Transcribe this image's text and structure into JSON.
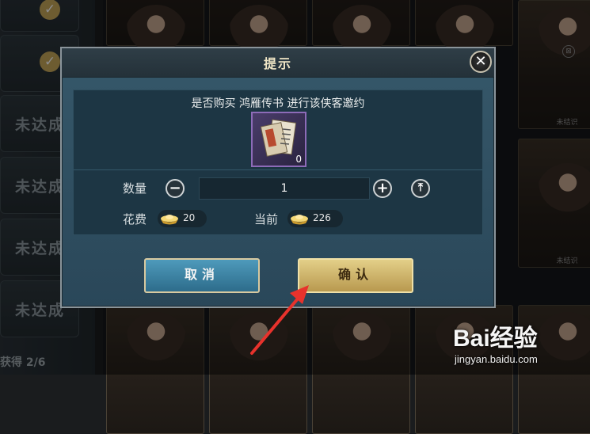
{
  "background": {
    "left_rows": [
      {
        "text": ""
      },
      {
        "text": ""
      },
      {
        "text": "未达成"
      },
      {
        "text": "未达成"
      },
      {
        "text": "未达成"
      },
      {
        "text": "未达成"
      }
    ],
    "progress_text": "获得 2/6",
    "card_status": "未结识"
  },
  "dialog": {
    "title": "提示",
    "close_icon": "close-icon",
    "question": "是否购买 鸿雁传书 进行该侠客邀约",
    "item": {
      "icon": "scroll-letter-icon",
      "count": "0"
    },
    "quantity": {
      "label": "数量",
      "value": "1"
    },
    "cost": {
      "label": "花费",
      "value": "20"
    },
    "current": {
      "label": "当前",
      "value": "226"
    },
    "buttons": {
      "cancel": "取消",
      "confirm": "确认"
    }
  },
  "watermark": {
    "brand": "Bai经验",
    "url": "jingyan.baidu.com"
  },
  "colors": {
    "accent_gold": "#e3cf88",
    "accent_blue": "#2d6c8b",
    "arrow": "#e8322c"
  }
}
